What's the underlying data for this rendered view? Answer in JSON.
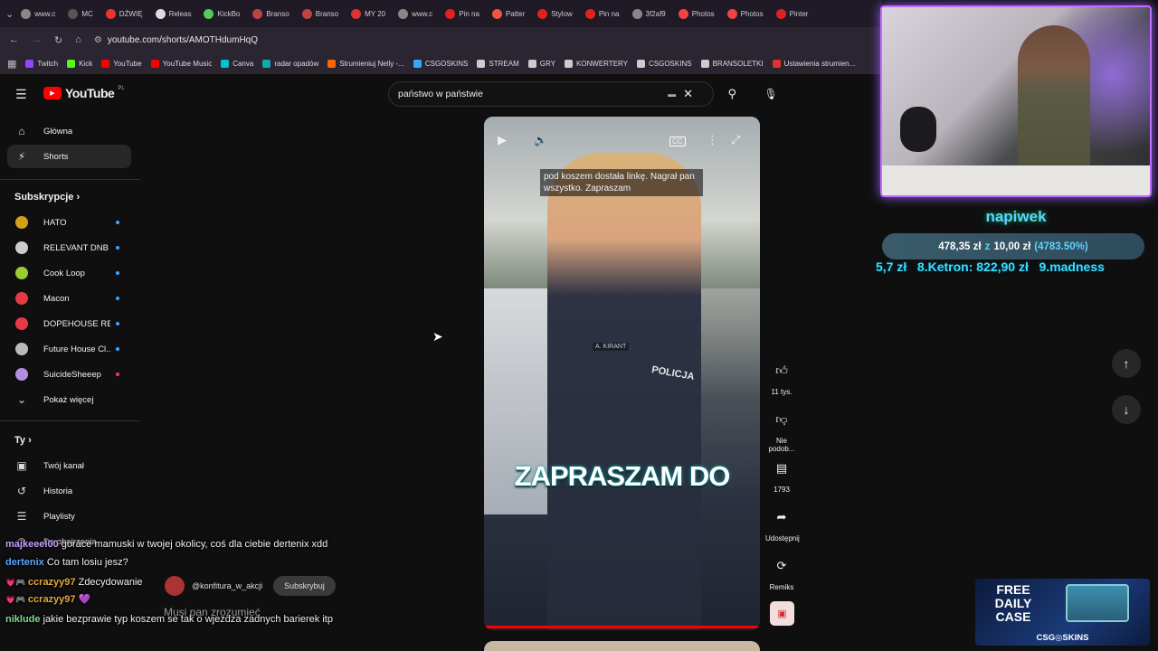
{
  "browser": {
    "tabs": [
      "www.c",
      "MC",
      "DŹWIĘ",
      "Releas",
      "KickBo",
      "Branso",
      "Branso",
      "MY 20",
      "www.c",
      "Pin na",
      "Patter",
      "Stylow",
      "Pin na",
      "3f2af9",
      "Photos",
      "Photos",
      "Pinter"
    ],
    "url": "youtube.com/shorts/AMOTHdumHqQ",
    "bookmarks": [
      "Twitch",
      "Kick",
      "YouTube",
      "YouTube Music",
      "Canva",
      "radar opadów",
      "Strumieniuj Nelly -...",
      "CSGOSKINS",
      "STREAM",
      "GRY",
      "KONWERTERY",
      "CSGOSKINS",
      "BRANSOLETKI",
      "Ustawienia strumien..."
    ]
  },
  "youtube": {
    "logo_text": "YouTube",
    "logo_region": "PL",
    "search_value": "państwo w państwie",
    "nav": [
      {
        "label": "Główna",
        "icon": "home-icon"
      },
      {
        "label": "Shorts",
        "icon": "shorts-icon"
      }
    ],
    "subscriptions_title": "Subskrypcje",
    "subscriptions": [
      {
        "label": "HATO",
        "color": "#d4a017"
      },
      {
        "label": "RELEVANT DNB",
        "color": "#cccccc"
      },
      {
        "label": "Cook Loop",
        "color": "#9acd32"
      },
      {
        "label": "Macon",
        "color": "#e63946"
      },
      {
        "label": "DOPEHOUSE RE...",
        "color": "#e63946"
      },
      {
        "label": "Future House Cl...",
        "color": "#bbbbbb"
      },
      {
        "label": "SuicideSheeep",
        "color": "#b48ee0"
      }
    ],
    "show_more": "Pokaż więcej",
    "you_title": "Ty",
    "you_items": [
      {
        "label": "Twój kanał",
        "icon": "user-box-icon"
      },
      {
        "label": "Historia",
        "icon": "history-icon"
      },
      {
        "label": "Playlisty",
        "icon": "playlist-icon"
      },
      {
        "label": "Do obejrzenia",
        "icon": "clock-icon"
      }
    ],
    "short": {
      "caption": "pod koszem dostała linkę. Nagrał pan wszystko. Zapraszam",
      "subtitle": "ZAPRASZAM DO",
      "badge_name": "A. KIRANT",
      "police": "POLICJA",
      "channel": "@konfitura_w_akcji",
      "subscribe": "Subskrybuj",
      "title": "Musi pan zrozumieć",
      "cc": "CC"
    },
    "actions": {
      "likes": "11 tys.",
      "dislike": "Nie podob...",
      "comments": "1793",
      "share": "Udostępnij",
      "remix": "Remiks"
    }
  },
  "stream_overlay": {
    "donation_title": "napiwek",
    "goal_current": "478,35 zł",
    "goal_of": "z",
    "goal_target": "10,00 zł",
    "goal_percent": "(4783.50%)",
    "ticker": "5,7 zł   8.Ketron: 822,90 zł   9.madness",
    "promo_line1": "FREE",
    "promo_line2": "DAILY",
    "promo_line3": "CASE",
    "promo_brand": "CSG◎SKINS"
  },
  "chat": [
    {
      "user": "majkeeel00",
      "color": "#c59cff",
      "msg": "gorace mamuski w twojej okolicy, coś dla ciebie dertenix xdd"
    },
    {
      "user": "dertenix",
      "color": "#5aa7ff",
      "msg": "Co tam losiu jesz?"
    },
    {
      "user": "ccrazyy97",
      "color": "#e0a93a",
      "msg": "Zdecydowanie"
    },
    {
      "user": "ccrazyy97",
      "color": "#e0a93a",
      "msg": "💜"
    },
    {
      "user": "niklude",
      "color": "#7ddc8c",
      "msg": "jakie bezprawie typ koszem se tak o wjezdza zadnych barierek itp"
    }
  ],
  "colors": {
    "accent": "#ff0000",
    "overlay_purple": "#9b5cff",
    "ticker_cyan": "#35e0ff"
  }
}
